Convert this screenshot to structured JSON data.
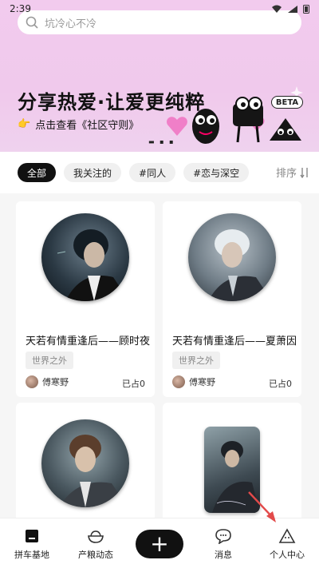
{
  "status_bar": {
    "time": "2:39"
  },
  "search": {
    "placeholder": "坑冷心不冷"
  },
  "banner": {
    "title": "分享热爱·让爱更纯粹",
    "subtitle": "点击查看《社区守则》",
    "beta": "BETA"
  },
  "filters": {
    "chips": [
      "全部",
      "我关注的",
      "#同人",
      "#恋与深空"
    ],
    "active_index": 0,
    "sort_label": "排序"
  },
  "cards": [
    {
      "title": "天若有情重逢后——顾时夜",
      "tag": "世界之外",
      "author": "傅寒野",
      "claimed": "已占0"
    },
    {
      "title": "天若有情重逢后——夏萧因",
      "tag": "世界之外",
      "author": "傅寒野",
      "claimed": "已占0"
    },
    {
      "title": "",
      "tag": "",
      "author": "",
      "claimed": ""
    },
    {
      "title": "",
      "tag": "",
      "author": "",
      "claimed": ""
    }
  ],
  "bottom_nav": {
    "items": [
      "拼车基地",
      "产粮动态",
      "",
      "消息",
      "个人中心"
    ]
  },
  "colors": {
    "banner_bg": "#f2cbee",
    "accent": "#111111",
    "arrow": "#e24a4a"
  }
}
